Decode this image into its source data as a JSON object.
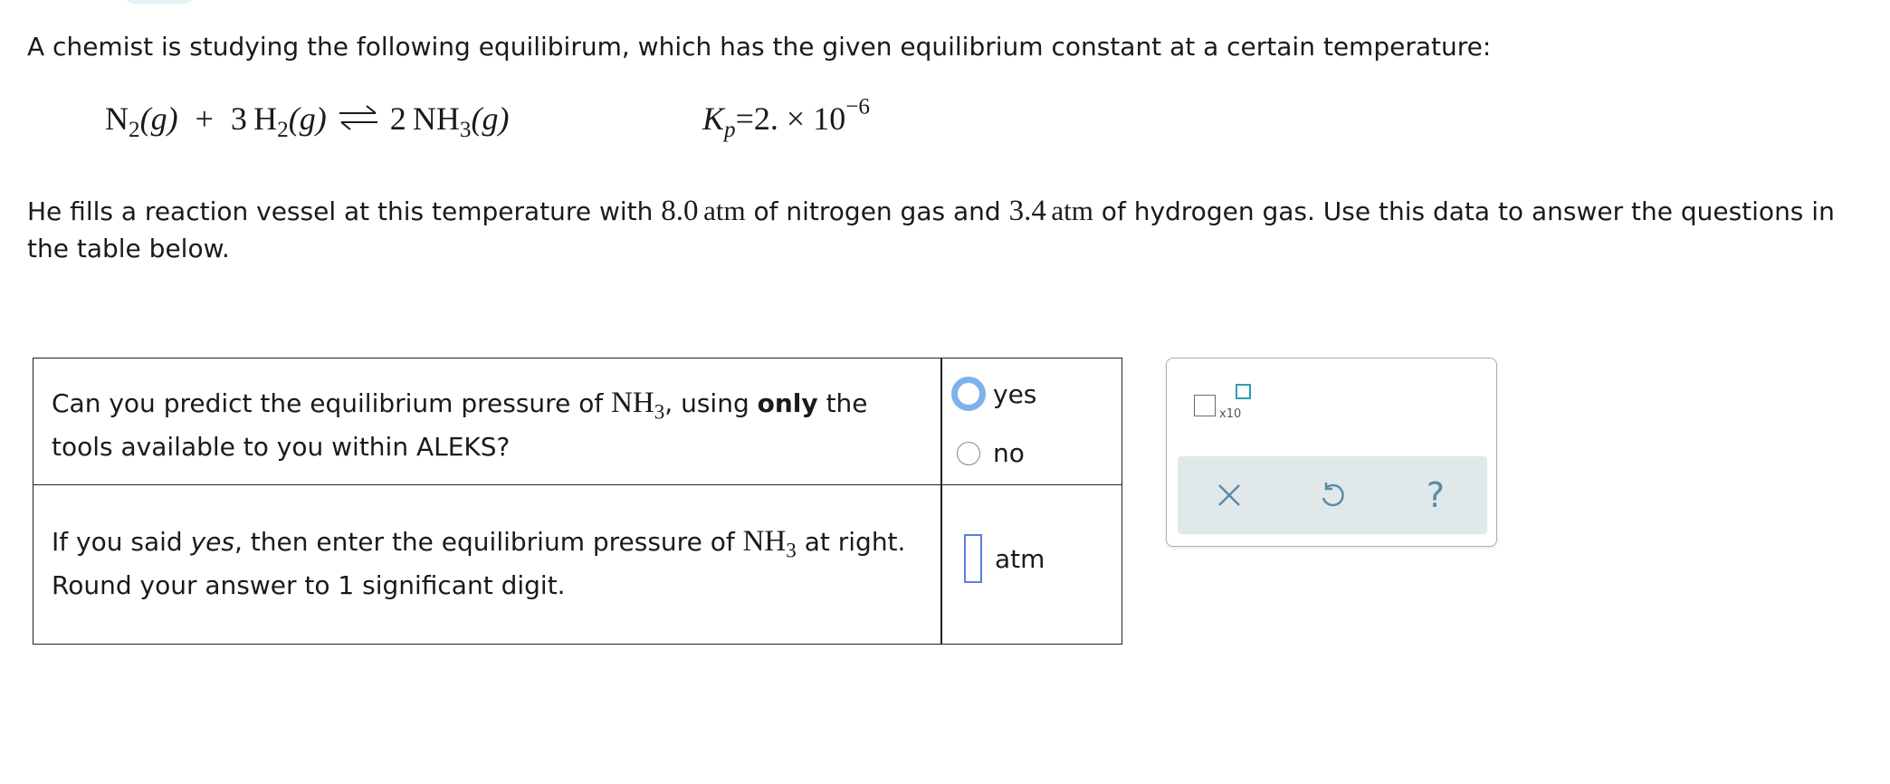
{
  "intro": "A chemist is studying the following equilibirum, which has the given equilibrium constant at a certain temperature:",
  "equation": {
    "reactant1": "N",
    "reactant1_sub": "2",
    "reactant1_state": "(g)",
    "plus": "+",
    "coef2": "3",
    "reactant2": "H",
    "reactant2_sub": "2",
    "reactant2_state": "(g)",
    "product_coef": "2",
    "product": "NH",
    "product_sub": "3",
    "product_state": "(g)",
    "kp_symbol": "K",
    "kp_sub": "p",
    "kp_value": "=2. × 10",
    "kp_exponent": "−6"
  },
  "intro2": {
    "part1": "He fills a reaction vessel at this temperature with ",
    "n2_value": "8.0",
    "n2_unit": "atm",
    "part2": " of nitrogen gas and ",
    "h2_value": "3.4",
    "h2_unit": "atm",
    "part3": " of hydrogen gas. Use this data to answer the questions in the table below."
  },
  "question1": {
    "text_before": "Can you predict the equilibrium pressure of ",
    "formula": "NH",
    "formula_sub": "3",
    "text_middle": ", using ",
    "emphasis": "only",
    "text_after": " the tools available to you within ALEKS?",
    "options": [
      "yes",
      "no"
    ],
    "selected": "yes"
  },
  "question2": {
    "text_before": "If you said ",
    "emphasis": "yes",
    "text_middle": ", then enter the equilibrium pressure of ",
    "formula": "NH",
    "formula_sub": "3",
    "text_after": " at right.",
    "line2": "Round your answer to 1 significant digit.",
    "answer_value": "",
    "unit": "atm"
  },
  "toolpanel": {
    "sci_notation_label": "x10",
    "tools": [
      "close-icon",
      "undo-icon",
      "help-icon"
    ],
    "help_glyph": "?"
  },
  "colors": {
    "radio_selected": "#7fb2ec",
    "answer_border": "#5b7fde",
    "toolbar_bg": "#e1e8ea",
    "icon": "#5b8ba6"
  }
}
